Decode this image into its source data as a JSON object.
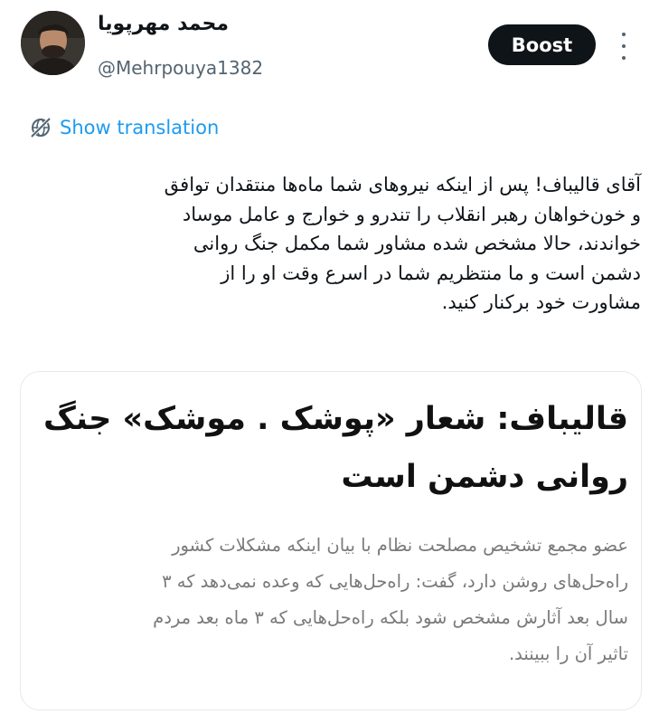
{
  "author": {
    "display_name": "محمد مهرپویا",
    "handle": "@Mehrpouya1382",
    "avatar_icon": "profile-photo"
  },
  "actions": {
    "boost_label": "Boost",
    "more_icon": "more-vertical-icon"
  },
  "translation": {
    "label": "Show translation",
    "icon": "globe-slash-icon",
    "color": "#1d9bf0"
  },
  "tweet": {
    "text": "آقای قالیباف! پس از اینکه نیروهای شما ماه‌ها منتقدان توافق\nو خون‌خواهان رهبر انقلاب را تندرو و خوارج و عامل موساد\nخواندند، حالا مشخص شده مشاور شما مکمل جنگ روانی\nدشمن است و ما منتظریم شما در اسرع وقت او را از\nمشاورت خود برکنار کنید."
  },
  "card": {
    "headline": "قالیباف: شعار «پوشک . موشک» جنگ\nروانی دشمن است",
    "body": "عضو مجمع تشخیص مصلحت نظام با بیان اینکه مشکلات کشور\nراه‌حل‌های روشن دارد، گفت: راه‌حل‌هایی که وعده نمی‌دهد که ۳\nسال بعد آثارش مشخص شود بلکه راه‌حل‌هایی که ۳ ماه بعد مردم\nتاثیر آن را ببینند."
  },
  "colors": {
    "text": "#0f1419",
    "secondary": "#536471",
    "button_bg": "#0f1419",
    "card_border": "#e6e9ec",
    "card_body": "#7a7a7a"
  }
}
